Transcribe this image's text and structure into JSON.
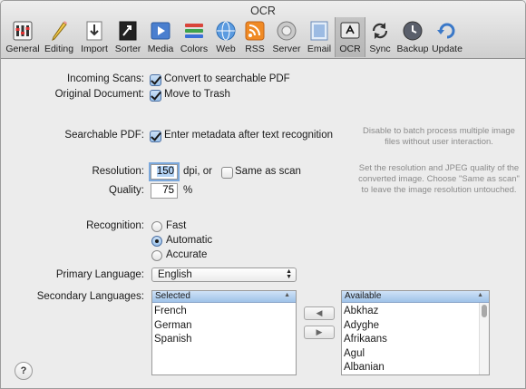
{
  "window": {
    "title": "OCR"
  },
  "toolbar": {
    "items": [
      {
        "label": "General",
        "icon": "general-icon"
      },
      {
        "label": "Editing",
        "icon": "pencil-icon"
      },
      {
        "label": "Import",
        "icon": "import-icon"
      },
      {
        "label": "Sorter",
        "icon": "sorter-icon"
      },
      {
        "label": "Media",
        "icon": "media-icon"
      },
      {
        "label": "Colors",
        "icon": "colors-icon"
      },
      {
        "label": "Web",
        "icon": "globe-icon"
      },
      {
        "label": "RSS",
        "icon": "rss-icon"
      },
      {
        "label": "Server",
        "icon": "server-icon"
      },
      {
        "label": "Email",
        "icon": "email-icon"
      },
      {
        "label": "OCR",
        "icon": "ocr-icon"
      },
      {
        "label": "Sync",
        "icon": "sync-icon"
      },
      {
        "label": "Backup",
        "icon": "backup-icon"
      },
      {
        "label": "Update",
        "icon": "update-icon"
      }
    ],
    "selected": "OCR"
  },
  "form": {
    "incoming_scans_label": "Incoming Scans:",
    "incoming_scans_option": "Convert to searchable PDF",
    "incoming_scans_checked": true,
    "original_document_label": "Original Document:",
    "original_document_option": "Move to Trash",
    "original_document_checked": true,
    "searchable_pdf_label": "Searchable PDF:",
    "searchable_pdf_option": "Enter metadata after text recognition",
    "searchable_pdf_checked": true,
    "searchable_pdf_help": "Disable to batch process multiple image files without user interaction.",
    "resolution_label": "Resolution:",
    "resolution_value": "150",
    "resolution_unit": "dpi, or",
    "same_as_scan_label": "Same as scan",
    "same_as_scan_checked": false,
    "quality_label": "Quality:",
    "quality_value": "75",
    "quality_unit": "%",
    "resolution_help": "Set the resolution and JPEG quality of the converted image. Choose \"Same as scan\" to leave the image resolution untouched.",
    "recognition_label": "Recognition:",
    "recognition_options": [
      "Fast",
      "Automatic",
      "Accurate"
    ],
    "recognition_selected": "Automatic",
    "primary_language_label": "Primary Language:",
    "primary_language_value": "English",
    "secondary_languages_label": "Secondary Languages:"
  },
  "selected_list": {
    "header": "Selected",
    "items": [
      "French",
      "German",
      "Spanish"
    ]
  },
  "available_list": {
    "header": "Available",
    "items": [
      "Abkhaz",
      "Adyghe",
      "Afrikaans",
      "Agul",
      "Albanian"
    ]
  },
  "buttons": {
    "add_arrow": "◀",
    "remove_arrow": "▶",
    "help": "?"
  }
}
